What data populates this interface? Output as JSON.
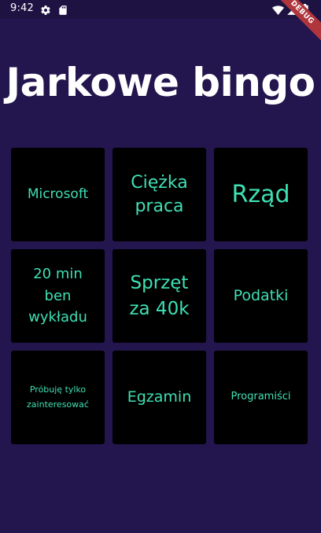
{
  "status_bar": {
    "time": "9:42",
    "icons": [
      "gear-icon",
      "sd-card-icon",
      "wifi-icon",
      "signal-icon",
      "battery-icon"
    ],
    "debug_label": "DEBUG"
  },
  "app": {
    "title": "Jarkowe bingo"
  },
  "colors": {
    "background": "#23154d",
    "tile_background": "#000000",
    "tile_text": "#3fe0b3",
    "title_text": "#ffffff",
    "debug_banner": "#b0363d"
  },
  "tiles": [
    {
      "label": "Microsoft"
    },
    {
      "label": "Ciężka praca"
    },
    {
      "label": "Rząd"
    },
    {
      "label": "20 min ben wykładu"
    },
    {
      "label": "Sprzęt za 40k"
    },
    {
      "label": "Podatki"
    },
    {
      "label": "Próbuję tylko zainteresować"
    },
    {
      "label": "Egzamin"
    },
    {
      "label": "Programiści"
    }
  ]
}
